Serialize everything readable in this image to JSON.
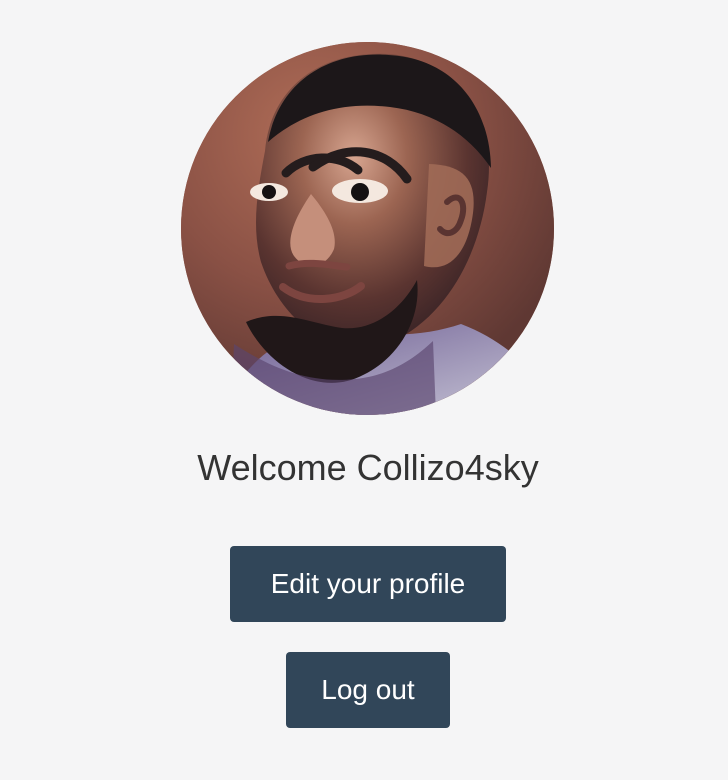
{
  "profile": {
    "avatar": "user-avatar-photo",
    "welcome_text": "Welcome Collizo4sky",
    "buttons": {
      "edit_profile_label": "Edit your profile",
      "logout_label": "Log out"
    }
  },
  "colors": {
    "page_background": "#f5f5f6",
    "button_background": "#314659",
    "button_text": "#ffffff",
    "heading_text": "#333333"
  }
}
